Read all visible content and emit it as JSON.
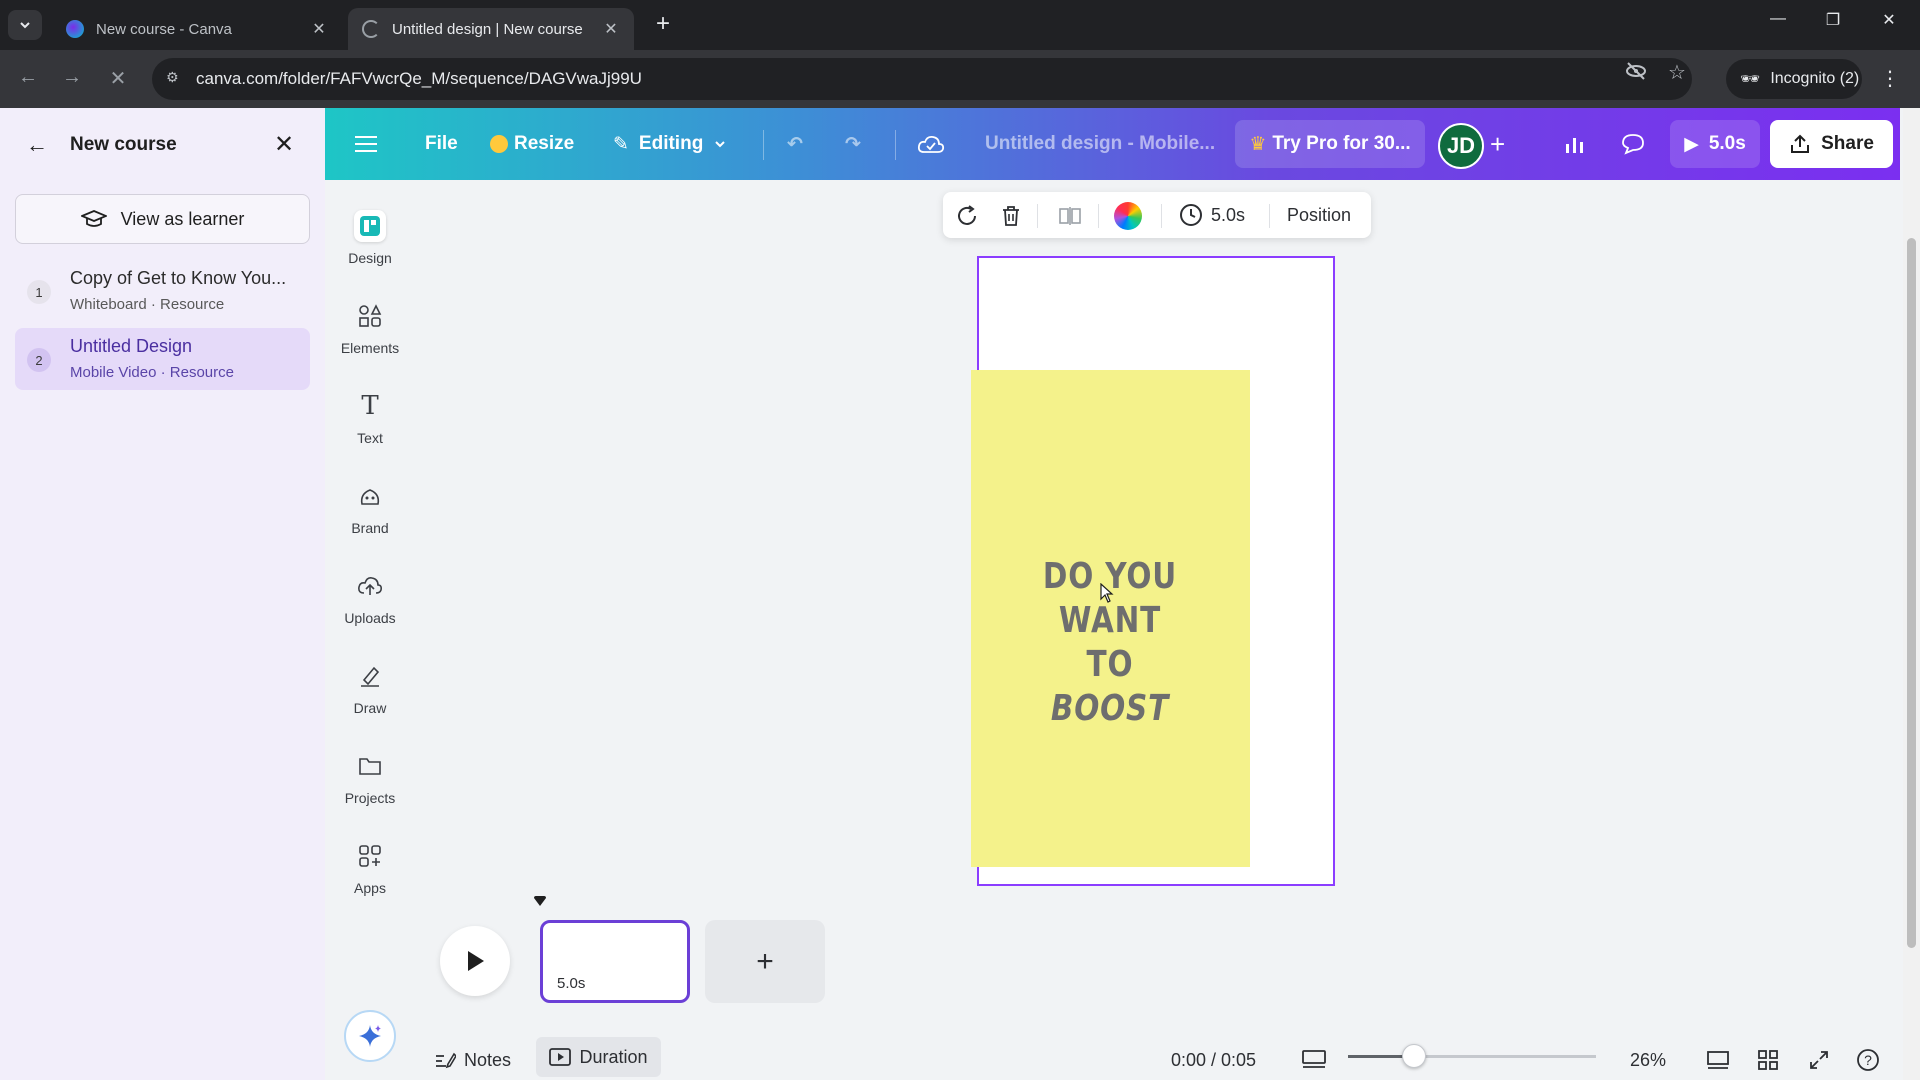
{
  "browser": {
    "tabs": [
      {
        "title": "New course - Canva"
      },
      {
        "title": "Untitled design | New course"
      }
    ],
    "url": "canva.com/folder/FAFVwcrQe_M/sequence/DAGVwaJj99U",
    "incognito_label": "Incognito (2)"
  },
  "course_panel": {
    "title": "New course",
    "view_as_learner": "View as learner",
    "items": [
      {
        "num": "1",
        "name": "Copy of Get to Know You...",
        "sub": "Whiteboard · Resource"
      },
      {
        "num": "2",
        "name": "Untitled Design",
        "sub": "Mobile Video · Resource"
      }
    ]
  },
  "topbar": {
    "file": "File",
    "resize": "Resize",
    "editing": "Editing",
    "doc_title": "Untitled design - Mobile...",
    "try_pro": "Try Pro for 30...",
    "avatar_initials": "JD",
    "play_duration": "5.0s",
    "share": "Share"
  },
  "sidebar": {
    "items": [
      {
        "label": "Design",
        "icon": "design-icon"
      },
      {
        "label": "Elements",
        "icon": "elements-icon"
      },
      {
        "label": "Text",
        "icon": "text-icon"
      },
      {
        "label": "Brand",
        "icon": "brand-icon"
      },
      {
        "label": "Uploads",
        "icon": "uploads-icon"
      },
      {
        "label": "Draw",
        "icon": "draw-icon"
      },
      {
        "label": "Projects",
        "icon": "projects-icon"
      },
      {
        "label": "Apps",
        "icon": "apps-icon"
      }
    ]
  },
  "context_toolbar": {
    "duration": "5.0s",
    "position": "Position"
  },
  "canvas": {
    "text_line1": "DO YOU",
    "text_line2": "WANT TO",
    "text_line3": "BOOST",
    "page_color": "#ffffff",
    "shape_color": "#f4f28b"
  },
  "timeline": {
    "clip_duration": "5.0s"
  },
  "bottombar": {
    "notes": "Notes",
    "duration": "Duration",
    "time": "0:00 / 0:05",
    "zoom": "26%",
    "zoom_level": 0.26
  },
  "colors": {
    "accent": "#8b3dff",
    "selected_item_bg": "#e5daf9"
  }
}
